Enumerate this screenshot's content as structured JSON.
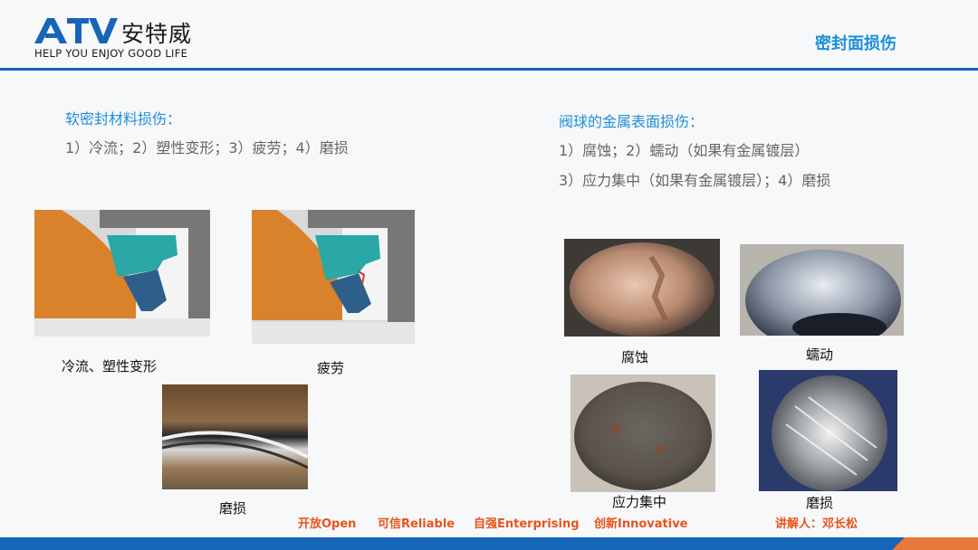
{
  "header": {
    "logo_text": "ATV",
    "logo_cn": "安特威",
    "tagline": "HELP YOU ENJOY GOOD LIFE",
    "title": "密封面损伤"
  },
  "left_section": {
    "title": "软密封材料损伤：",
    "line1": "1）冷流；2）塑性变形；3）疲劳；4）磨损"
  },
  "right_section": {
    "title": "阀球的金属表面损伤：",
    "line1": "1）腐蚀；2）蠕动（如果有金属镀层）",
    "line2": "3）应力集中（如果有金属镀层）；4）磨损"
  },
  "captions": {
    "cold_flow": "冷流、塑性变形",
    "fatigue": "疲劳",
    "wear_left": "磨损",
    "corrosion": "腐蚀",
    "creep": "蠕动",
    "stress": "应力集中",
    "wear_right": "磨损"
  },
  "footer": {
    "open": "开放Open",
    "reliable": "可信Reliable",
    "enterprising": "自强Enterprising",
    "innovative": "创新Innovative",
    "speaker": "讲解人：邓长松"
  },
  "colors": {
    "brand_blue": "#1565b8",
    "title_blue": "#1e8fd8",
    "footer_orange": "#e8531c"
  }
}
